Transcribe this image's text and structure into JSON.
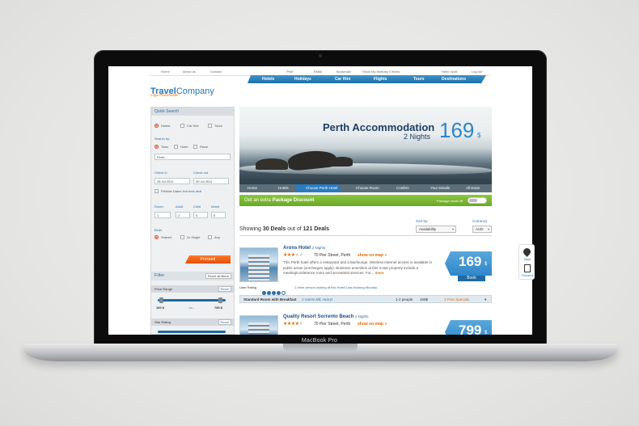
{
  "device": {
    "label": "MacBook Pro"
  },
  "topnav": {
    "home": "Home",
    "about": "About us",
    "contact": "Contact",
    "print": "Print",
    "email": "EMail",
    "bookmark": "Bookmark",
    "itinerary": "Show My Itinerary 0 items",
    "hello": "Hello Scott",
    "logout": "Log out"
  },
  "mainnav": {
    "items": [
      "Hotels",
      "Holidays",
      "Car Hire",
      "Flights",
      "Tours",
      "Destinations"
    ]
  },
  "logo": {
    "part1": "Travel",
    "part2": "Company",
    "sub": "Logo Placeholder"
  },
  "search": {
    "title": "Quick Search",
    "types": [
      "Hotels",
      "Car Hire",
      "Tours"
    ],
    "search_by_label": "Search by:",
    "search_by": [
      "Town",
      "Hotel",
      "Place"
    ],
    "destination": "Perth",
    "checkin_label": "Check in",
    "checkin": "28 Jul 2011",
    "checkout_label": "Check out",
    "checkout": "30 Jul 2011",
    "flexible": "Flexible Dates",
    "flexible_link": "find best deal",
    "room_label": "Room",
    "room": "1",
    "adult_label": "Adult",
    "adult": "2",
    "child_label": "Child",
    "child": "0",
    "infant_label": "Infant",
    "infant": "0",
    "beds_label": "Beds",
    "beds": [
      "Shared",
      "2x Single",
      "Any"
    ],
    "proceed": "Proceed"
  },
  "filter": {
    "title": "Filter",
    "reset_all": "Reset all filters",
    "price_label": "Price Range",
    "reset": "Reset",
    "price_min": "100 $",
    "price_to": "to",
    "price_max": "780 $",
    "price_range_fraction": [
      0.05,
      0.92
    ],
    "star_label": "Star Rating",
    "reset2": "Reset"
  },
  "hero": {
    "title": "Perth Accommodation",
    "nights": "2 Nights",
    "price": "169",
    "currency": "$"
  },
  "breadcrumbs": [
    "Home",
    "Hotels",
    "Choose Perth Hotel",
    "Choose Room",
    "Confirm",
    "Your Details",
    "All Done"
  ],
  "promo": {
    "text": "Get an extra",
    "bold": "Package Discount",
    "mode": "Package mode off"
  },
  "results": {
    "showing_prefix": "Showing",
    "deals": "30 Deals",
    "outof": "out of",
    "total": "121 Deals",
    "sortby_label": "Sort by:",
    "sortby": "Availability",
    "currency_label": "Currency:",
    "currency": "AUD"
  },
  "hotels": [
    {
      "name": "Arons Hotel",
      "nights": "2 Nights",
      "stars_filled": 3,
      "stars_total": 5,
      "address": "70 Pier Street, Perth",
      "map": "show on map »",
      "desc": "This Perth hotel offers a restaurant and a bar/lounge. Wireless Internet access is available in public areas (surcharges apply). Business amenities at this 3-star property include a meeting/conference room and secretarial services. For...",
      "more": "more",
      "price": "169",
      "currency": "$",
      "book": "Book",
      "rating_label": "User Rating",
      "rating_filled": 4,
      "rating_total": 5,
      "rating_text": "1 other person looking at this Hotel! Last booking Monday",
      "room": "Standard Room with Breakfast",
      "room_note": "2 rooms left, Hurry!",
      "people": "1-2 people",
      "room_price": "169$",
      "specials": "3 Free Specials"
    },
    {
      "name": "Quality Resort Sorrento Beach",
      "nights": "2 Nights",
      "stars_filled": 4,
      "stars_total": 5,
      "address": "70 Pier Street, Perth",
      "map": "show on map »",
      "price": "799",
      "currency": "$"
    }
  ],
  "sidetool": {
    "map": "Maps",
    "doc": "Checkout"
  }
}
